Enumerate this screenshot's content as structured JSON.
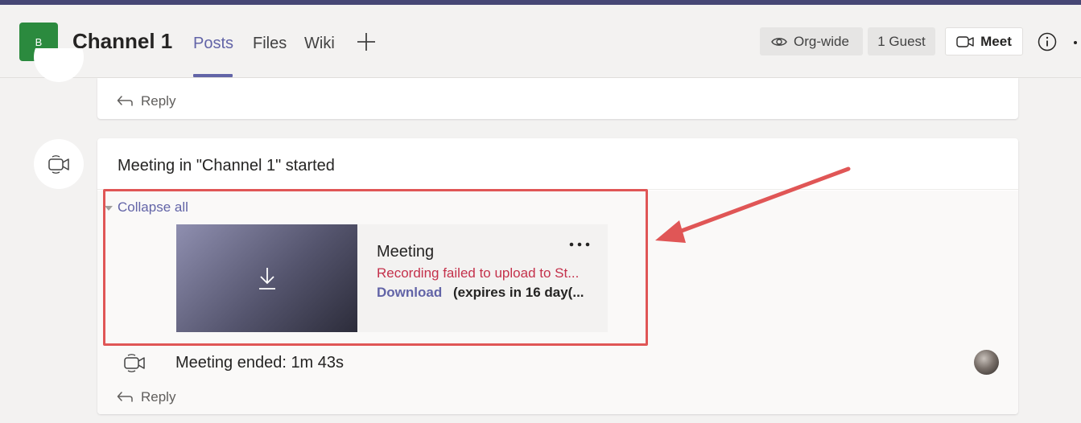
{
  "header": {
    "team_avatar_letter": "B",
    "channel_title": "Channel 1",
    "tabs": [
      {
        "label": "Posts",
        "active": true
      },
      {
        "label": "Files",
        "active": false
      },
      {
        "label": "Wiki",
        "active": false
      }
    ],
    "add_tab_icon": "plus-icon",
    "org_wide_label": "Org-wide",
    "guest_label": "1 Guest",
    "meet_label": "Meet",
    "info_icon": "info-icon"
  },
  "top_card": {
    "reply_label": "Reply"
  },
  "meeting_card": {
    "title": "Meeting in \"Channel 1\" started",
    "collapse_label": "Collapse all",
    "recording": {
      "title": "Meeting",
      "error": "Recording failed to upload to St...",
      "download_label": "Download",
      "expires": "(expires in 16 day(..."
    },
    "ended_text": "Meeting ended: 1m 43s",
    "reply_label": "Reply"
  },
  "colors": {
    "brand": "#6264a7",
    "error": "#c4314b",
    "team_avatar": "#2b8a3e",
    "highlight": "#e05656"
  }
}
